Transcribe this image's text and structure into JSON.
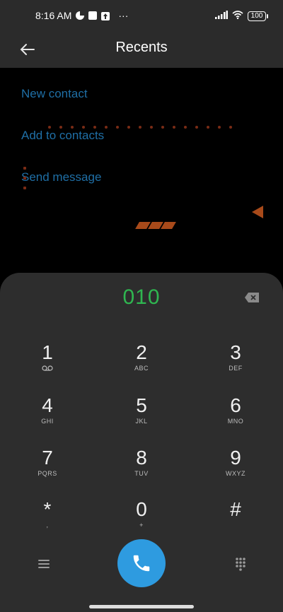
{
  "status_bar": {
    "time": "8:16 AM",
    "left_icons": [
      "pie-icon",
      "square-icon",
      "upload-icon",
      "more-icon"
    ],
    "more_text": "···",
    "battery_level": "100",
    "right_icons": [
      "signal-icon",
      "wifi-icon",
      "battery-icon"
    ]
  },
  "header": {
    "back_icon": "arrow-left-icon",
    "title": "Recents"
  },
  "options": {
    "items": [
      {
        "label": "New contact"
      },
      {
        "label": "Add to contacts"
      },
      {
        "label": "Send message"
      }
    ],
    "link_color": "#1f6fa6"
  },
  "dialpad": {
    "number": "010",
    "number_color": "#2fb650",
    "backspace_icon": "backspace-icon",
    "keys": [
      {
        "digit": "1",
        "letters": "",
        "icon": "voicemail-icon"
      },
      {
        "digit": "2",
        "letters": "ABC"
      },
      {
        "digit": "3",
        "letters": "DEF"
      },
      {
        "digit": "4",
        "letters": "GHI"
      },
      {
        "digit": "5",
        "letters": "JKL"
      },
      {
        "digit": "6",
        "letters": "MNO"
      },
      {
        "digit": "7",
        "letters": "PQRS"
      },
      {
        "digit": "8",
        "letters": "TUV"
      },
      {
        "digit": "9",
        "letters": "WXYZ"
      },
      {
        "digit": "*",
        "letters": ","
      },
      {
        "digit": "0",
        "letters": "+"
      },
      {
        "digit": "#",
        "letters": ""
      }
    ],
    "bottom": {
      "menu_icon": "hamburger-menu-icon",
      "call_icon": "phone-icon",
      "call_color": "#2e9be0",
      "grid_icon": "dialpad-grid-icon"
    }
  }
}
